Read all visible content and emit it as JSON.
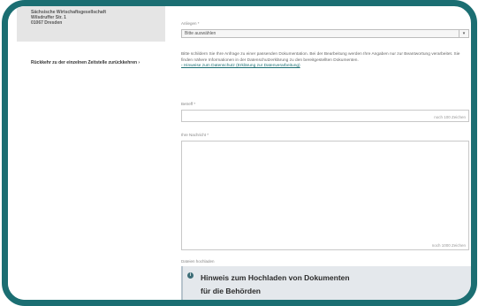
{
  "sidebar": {
    "address_lines": [
      "Sächsische Wirtschaftsgesellschaft",
      "Wilsdruffer Str. 1",
      "01067 Dresden"
    ],
    "link": "Rückkehr zu der einzelnen Zeitstelle zurückkehren ›"
  },
  "form": {
    "topic_label": "Anliegen *",
    "topic_value": "Bitte auswählen",
    "info_text": "Bitte schildern Sie Ihre Anfrage zu einer passenden Dokumentation. Bei der Bearbeitung werden Ihre Angaben nur zur Beantwortung verarbeitet. Sie finden nähere Informationen in der Datenschutzerklärung zu den bereitgestellten Dokumenten.",
    "info_link": "› Hinweise zum Datenschutz (Erklärung zur Datenverarbeitung)",
    "subject_label": "Betreff *",
    "subject_counter": "noch 100 Zeichen",
    "message_label": "Ihre Nachricht *",
    "message_counter": "noch 1000 Zeichen",
    "attachment_label": "Dateien hochladen",
    "notice_title": "Hinweis zum Hochladen von Dokumenten",
    "notice_subtitle": "für die Behörden"
  }
}
